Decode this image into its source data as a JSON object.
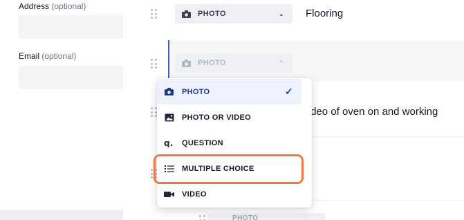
{
  "form": {
    "address": {
      "label": "Address",
      "optional": "(optional)",
      "value": ""
    },
    "email": {
      "label": "Email",
      "optional": "(optional)",
      "value": ""
    }
  },
  "rows": [
    {
      "type_label": "PHOTO",
      "text": "Flooring"
    },
    {
      "type_label": "PHOTO",
      "text": ""
    },
    {
      "type_label": "",
      "text": "Video of oven on and working"
    },
    {
      "type_label": "",
      "text": ""
    },
    {
      "type_label": "PHOTO",
      "text": ""
    }
  ],
  "dropdown": {
    "items": [
      {
        "label": "PHOTO",
        "icon": "camera-icon",
        "selected": true
      },
      {
        "label": "PHOTO OR VIDEO",
        "icon": "image-icon",
        "selected": false
      },
      {
        "label": "QUESTION",
        "icon": "question-icon",
        "selected": false
      },
      {
        "label": "MULTIPLE CHOICE",
        "icon": "list-icon",
        "selected": false,
        "highlighted": true
      },
      {
        "label": "VIDEO",
        "icon": "video-camera-icon",
        "selected": false
      }
    ],
    "check_glyph": "✓"
  },
  "colors": {
    "accent": "#3b5bdb",
    "highlight": "#ea7a45",
    "selected_bg": "#eef2ff"
  }
}
